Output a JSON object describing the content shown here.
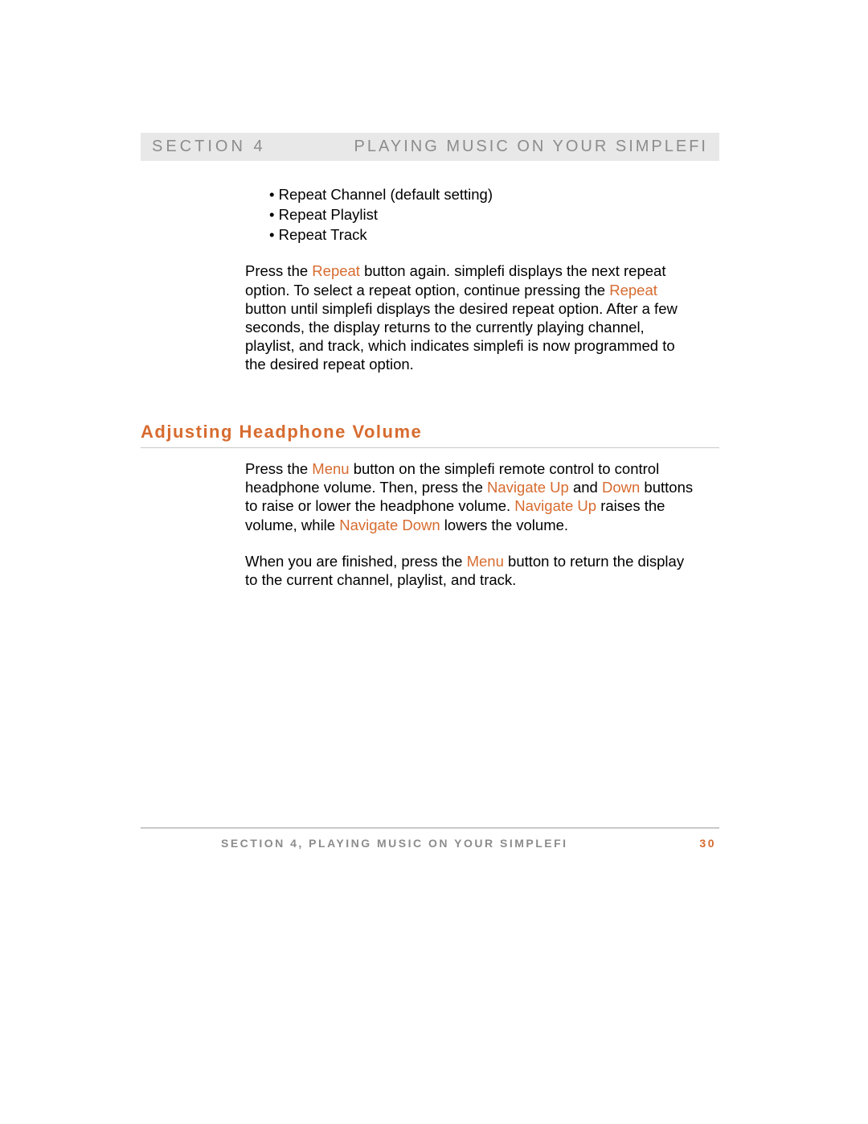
{
  "header": {
    "section_label": "SECTION 4",
    "section_title": "PLAYING MUSIC ON YOUR SIMPLEFI"
  },
  "bullets": {
    "b1": "Repeat Channel (default setting)",
    "b2": "Repeat Playlist",
    "b3": "Repeat Track"
  },
  "para1": {
    "t1": "Press the ",
    "k1": "Repeat",
    "t2": " button again.  simplefi displays the next repeat option.  To select a repeat option, continue pressing the ",
    "k2": "Repeat",
    "t3": " button until simplefi displays the desired repeat option.  After a few seconds, the display returns to the currently playing channel, playlist, and track, which indicates simplefi is now programmed to the desired repeat option."
  },
  "subheading": "Adjusting Headphone Volume",
  "para2": {
    "t1": "Press the ",
    "k1": "Menu",
    "t2": " button on the simplefi remote control to control headphone volume.  Then, press the ",
    "k2": "Navigate Up",
    "t3": " and ",
    "k3": "Down",
    "t4": " buttons to raise or lower the headphone volume.  ",
    "k4": "Navigate Up",
    "t5": " raises the volume, while ",
    "k5": "Navigate Down",
    "t6": " lowers the volume."
  },
  "para3": {
    "t1": "When you are finished, press the ",
    "k1": "Menu",
    "t2": " button to return the display to the current channel, playlist, and track."
  },
  "footer": {
    "text": "SECTION 4, PLAYING MUSIC ON YOUR SIMPLEFI",
    "page": "30"
  }
}
